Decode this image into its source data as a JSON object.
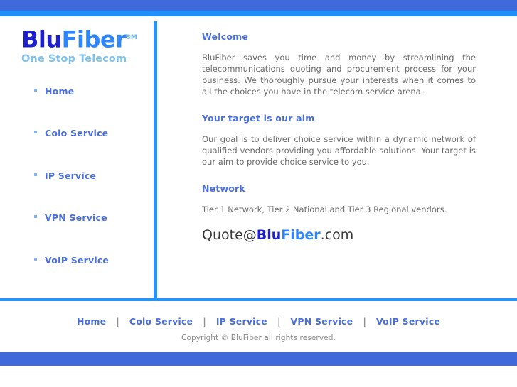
{
  "site": {
    "brand_prefix": "Blu",
    "brand_suffix": "Fiber",
    "service_mark": "SM",
    "tagline": "One Stop Telecom"
  },
  "colors": {
    "brand_dark_blue": "#1f1fd2",
    "brand_light_blue": "#2f86fb",
    "bar_dark": "#4069dc",
    "bar_light": "#1f90ff",
    "divider": "#2196f8",
    "heading": "#4a6fdd",
    "body_text": "#6b6b6b",
    "tagline": "#7cc2f2",
    "bullet": "#7fb4f2"
  },
  "sidebar": {
    "items": [
      {
        "label": "Home"
      },
      {
        "label": "Colo Service"
      },
      {
        "label": "IP Service"
      },
      {
        "label": "VPN Service"
      },
      {
        "label": "VoIP Service"
      }
    ]
  },
  "main": {
    "sections": [
      {
        "heading": "Welcome",
        "body": "BluFiber saves you time and money by streamlining the telecommunications quoting and procurement process for your business. We thoroughly pursue your interests when it comes to all the choices you have in the telecom service arena."
      },
      {
        "heading": "Your target is our aim",
        "body": "Our goal is to deliver choice service within a dynamic network of qualified vendors providing you affordable solutions. Your target is our aim to provide choice service to you."
      },
      {
        "heading": "Network",
        "body": "Tier 1 Network, Tier 2 National and Tier 3 Regional vendors."
      }
    ],
    "email": {
      "local_part": "Quote@",
      "brand_prefix": "Blu",
      "brand_suffix": "Fiber",
      "tld": ".com"
    }
  },
  "footer": {
    "links": [
      {
        "label": "Home"
      },
      {
        "label": "Colo Service"
      },
      {
        "label": "IP Service"
      },
      {
        "label": "VPN Service"
      },
      {
        "label": "VoIP Service"
      }
    ],
    "separator": "|",
    "copyright": "Copyright © BluFiber all rights reserved."
  }
}
